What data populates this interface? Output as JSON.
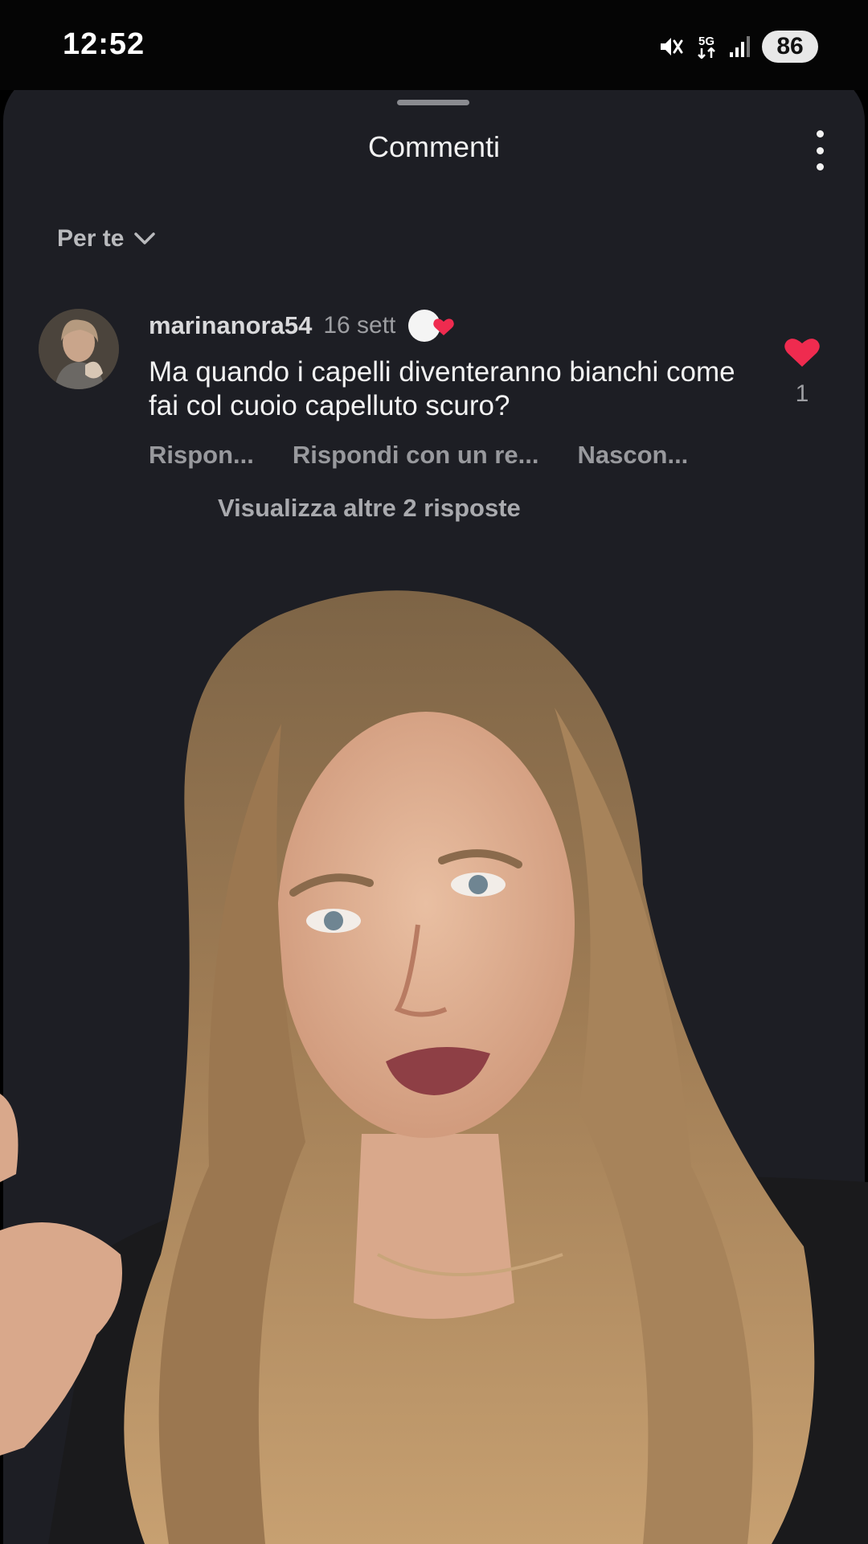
{
  "status_bar": {
    "time": "12:52",
    "network": "5G",
    "battery": "86",
    "icons": [
      "mute-vibrate-icon",
      "network-5g-icon",
      "signal-icon",
      "battery-icon"
    ]
  },
  "sheet": {
    "title": "Commenti",
    "sort_label": "Per te"
  },
  "comment": {
    "username": "marinanora54",
    "date": "16 sett",
    "text": "Ma quando i capelli diventeranno bianchi come fai col cuoio capelluto scuro?",
    "likes": "1",
    "actions": {
      "reply": "Rispon...",
      "reply_with_video": "Rispondi con un re...",
      "hide": "Nascon..."
    },
    "view_replies": "Visualizza altre 2 risposte"
  },
  "colors": {
    "sheet_background": "#1d1e24",
    "like_red": "#ef2b4f",
    "text_primary": "#f3f3f3",
    "text_secondary": "#9d9ea2"
  }
}
